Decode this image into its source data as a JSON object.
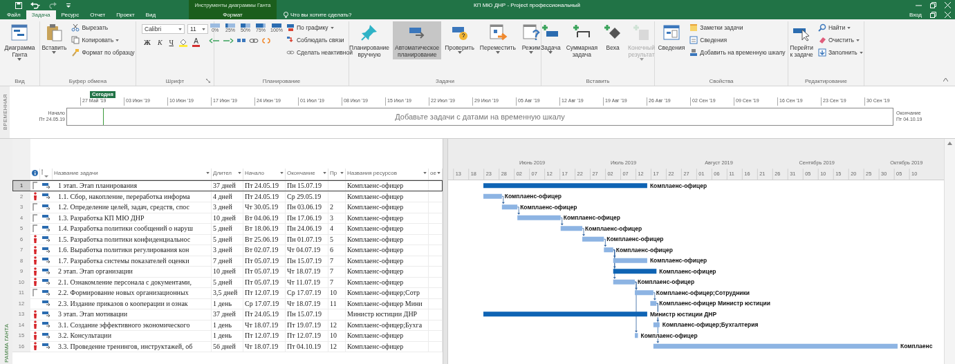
{
  "title_bar": {
    "context_label": "Инструменты диаграммы Ганта",
    "title": "КП МЮ ДНР - Project профессиональный"
  },
  "tabs": [
    {
      "label": "Файл",
      "selected": false,
      "kind": "main"
    },
    {
      "label": "Задача",
      "selected": true,
      "kind": "main"
    },
    {
      "label": "Ресурс",
      "selected": false,
      "kind": "main"
    },
    {
      "label": "Отчет",
      "selected": false,
      "kind": "main"
    },
    {
      "label": "Проект",
      "selected": false,
      "kind": "main"
    },
    {
      "label": "Вид",
      "selected": false,
      "kind": "main"
    },
    {
      "label": "Формат",
      "selected": false,
      "kind": "contextual"
    }
  ],
  "tell_me": "Что вы хотите сделать?",
  "sign_in": "Вход",
  "ribbon": {
    "groups": [
      {
        "label": "Вид",
        "items": [
          {
            "kind": "large",
            "label": "Диаграмма\nГанта",
            "dropdown": true
          }
        ]
      },
      {
        "label": "Буфер обмена",
        "items": [
          {
            "kind": "large",
            "label": "Вставить",
            "dropdown": true
          },
          {
            "kind": "stack",
            "items": [
              {
                "label": "Вырезать"
              },
              {
                "label": "Копировать",
                "dropdown": true
              },
              {
                "label": "Формат по образцу"
              }
            ]
          }
        ]
      },
      {
        "label": "Шрифт",
        "launcher": true,
        "items": [
          {
            "kind": "font",
            "font": "Calibri",
            "size": "11",
            "styles": [
              "Ж",
              "К",
              "Ч"
            ],
            "color_letter": "A"
          }
        ]
      },
      {
        "label": "Планирование",
        "items": [
          {
            "kind": "progress",
            "percents": [
              "0%",
              "25%",
              "50%",
              "75%",
              "100%"
            ]
          },
          {
            "kind": "stack",
            "items": [
              {
                "label": "По графику",
                "dropdown": true
              },
              {
                "label": "Соблюдать связи"
              },
              {
                "label": "Сделать неактивной"
              }
            ]
          }
        ]
      },
      {
        "label": "Задачи",
        "items": [
          {
            "kind": "large",
            "label": "Планирование\nвручную",
            "selected": false
          },
          {
            "kind": "large",
            "label": "Автоматическое\nпланирование",
            "selected": true
          },
          {
            "kind": "large",
            "label": "Проверить",
            "dropdown": true,
            "selected": false
          },
          {
            "kind": "large",
            "label": "Переместить",
            "dropdown": true,
            "selected": false
          },
          {
            "kind": "large",
            "label": "Режим",
            "dropdown": true,
            "selected": false
          }
        ]
      },
      {
        "label": "Вставить",
        "items": [
          {
            "kind": "large",
            "label": "Задача",
            "dropdown": true,
            "disabled": false
          },
          {
            "kind": "large",
            "label": "Суммарная\nзадача",
            "disabled": false
          },
          {
            "kind": "large",
            "label": "Веха",
            "disabled": false
          },
          {
            "kind": "large",
            "label": "Конечный\nрезультат",
            "dropdown": true,
            "disabled": true
          }
        ]
      },
      {
        "label": "Свойства",
        "items": [
          {
            "kind": "large",
            "label": "Сведения"
          },
          {
            "kind": "stack",
            "items": [
              {
                "label": "Заметки задачи"
              },
              {
                "label": "Сведения"
              },
              {
                "label": "Добавить на временную шкалу"
              }
            ]
          }
        ]
      },
      {
        "label": "Редактирование",
        "items": [
          {
            "kind": "large",
            "label": "Перейти\nк задаче"
          },
          {
            "kind": "stack",
            "items": [
              {
                "label": "Найти",
                "dropdown": true
              },
              {
                "label": "Очистить",
                "dropdown": true
              },
              {
                "label": "Заполнить",
                "dropdown": true
              }
            ]
          }
        ]
      }
    ]
  },
  "timeline": {
    "side_label": "ВРЕМЕННАЯ",
    "today": "Сегодня",
    "dates": [
      "27 Май '19",
      "03 Июн '19",
      "10 Июн '19",
      "17 Июн '19",
      "24 Июн '19",
      "01 Июл '19",
      "08 Июл '19",
      "15 Июл '19",
      "22 Июл '19",
      "29 Июл '19",
      "05 Авг '19",
      "12 Авг '19",
      "19 Авг '19",
      "26 Авг '19",
      "02 Сен '19",
      "09 Сен '19",
      "16 Сен '19",
      "23 Сен '19",
      "30 Сен '19"
    ],
    "start_label": "Начало",
    "start_date": "Пт 24.05.19",
    "placeholder": "Добавьте задачи с датами на временную шкалу",
    "end_label": "Окончание",
    "end_date": "Пт 04.10.19"
  },
  "view_label": "РАММА ГАНТА",
  "table": {
    "columns": [
      {
        "label": "Название задачи"
      },
      {
        "label": "Длител"
      },
      {
        "label": "Начало"
      },
      {
        "label": "Окончание"
      },
      {
        "label": "Пр"
      },
      {
        "label": "Названия ресурсов"
      },
      {
        "label": "ое"
      }
    ],
    "rows": [
      {
        "id": "1",
        "constraint": true,
        "overallocated": false,
        "name": "1 этап. Этап планирования",
        "duration": "37 дней",
        "start": "Пт 24.05.19",
        "finish": "Пн 15.07.19",
        "resources": "Комплаенс-офицер",
        "kind": "summary",
        "bar_label": "Комплаенс-офицер",
        "selected": true
      },
      {
        "id": "2",
        "constraint": false,
        "overallocated": true,
        "name": "1.1. Сбор, накопление, переработка информа",
        "duration": "4 дней",
        "start": "Пт 24.05.19",
        "finish": "Ср 29.05.19",
        "resources": "Комплаенс-офицер",
        "kind": "task",
        "bar_label": "Комплаенс-офицер",
        "selected": false
      },
      {
        "id": "3",
        "constraint": true,
        "overallocated": false,
        "name": "1.2. Определение целей, задач, средств, спос",
        "duration": "3 дней",
        "start": "Чт 30.05.19",
        "finish": "Пн 03.06.19",
        "predecessors": "2",
        "resources": "Комплаенс-офицер",
        "kind": "task",
        "bar_label": "Комплаенс-офицер",
        "selected": false
      },
      {
        "id": "4",
        "constraint": true,
        "overallocated": false,
        "name": "1.3. Разработка КП МЮ ДНР",
        "duration": "10 дней",
        "start": "Вт 04.06.19",
        "finish": "Пн 17.06.19",
        "predecessors": "3",
        "resources": "Комплаенс-офицер",
        "kind": "task",
        "bar_label": "Комплаенс-офицер",
        "selected": false
      },
      {
        "id": "5",
        "constraint": true,
        "overallocated": false,
        "name": "1.4. Разработка политики сообщений о наруш",
        "duration": "5 дней",
        "start": "Вт 18.06.19",
        "finish": "Пн 24.06.19",
        "predecessors": "4",
        "resources": "Комплаенс-офицер",
        "kind": "task",
        "bar_label": "Комплаенс-офицер",
        "selected": false
      },
      {
        "id": "6",
        "constraint": false,
        "overallocated": true,
        "name": "1.5. Разработка политики конфиденциальнос",
        "duration": "5 дней",
        "start": "Вт 25.06.19",
        "finish": "Пн 01.07.19",
        "predecessors": "5",
        "resources": "Комплаенс-офицер",
        "kind": "task",
        "bar_label": "Комплаенс-офицер",
        "selected": false
      },
      {
        "id": "7",
        "constraint": false,
        "overallocated": true,
        "name": "1.6. Выработка политики регулирования кон",
        "duration": "3 дней",
        "start": "Вт 02.07.19",
        "finish": "Чт 04.07.19",
        "predecessors": "6",
        "resources": "Комплаенс-офицер",
        "kind": "task",
        "bar_label": "Комплаенс-офицер",
        "selected": false
      },
      {
        "id": "8",
        "constraint": false,
        "overallocated": true,
        "name": "1.7. Разработка системы показателей оценки",
        "duration": "7 дней",
        "start": "Пт 05.07.19",
        "finish": "Пн 15.07.19",
        "predecessors": "7",
        "resources": "Комплаенс-офицер",
        "kind": "task",
        "bar_label": "Комплаенс-офицер",
        "selected": false
      },
      {
        "id": "9",
        "constraint": false,
        "overallocated": true,
        "name": "2 этап. Этап организации",
        "duration": "10 дней",
        "start": "Пт 05.07.19",
        "finish": "Чт 18.07.19",
        "predecessors": "7",
        "resources": "Комплаенс-офицер",
        "kind": "summary",
        "bar_label": "Комплаенс-офицер",
        "selected": false
      },
      {
        "id": "10",
        "constraint": false,
        "overallocated": true,
        "name": "2.1. Ознакомление персонала с документами,",
        "duration": "5 дней",
        "start": "Пт 05.07.19",
        "finish": "Чт 11.07.19",
        "predecessors": "7",
        "resources": "Комплаенс-офицер",
        "kind": "task",
        "bar_label": "Комплаенс-офицер",
        "selected": false
      },
      {
        "id": "11",
        "constraint": true,
        "overallocated": false,
        "name": "2.2. Формирование новых организационных",
        "duration": "3,5 дней",
        "start": "Пт 12.07.19",
        "finish": "Ср 17.07.19",
        "predecessors": "10",
        "resources": "Комплаенс-офицер;Сотр",
        "kind": "task",
        "bar_label": "Комплаенс-офицер;Сотрудники",
        "selected": false
      },
      {
        "id": "12",
        "constraint": false,
        "overallocated": false,
        "name": "2.3. Издание приказов о кооперации и ознак",
        "duration": "1 день",
        "start": "Ср 17.07.19",
        "finish": "Чт 18.07.19",
        "predecessors": "11",
        "resources": "Комплаенс-офицер Мини",
        "kind": "task",
        "bar_label": "Комплаенс-офицер Министр юстиции",
        "selected": false
      },
      {
        "id": "13",
        "constraint": false,
        "overallocated": true,
        "name": "3 этап. Этап мотивации",
        "duration": "37 дней",
        "start": "Пт 24.05.19",
        "finish": "Пн 15.07.19",
        "resources": "Министр юстиции ДНР",
        "kind": "summary",
        "bar_label": "Министр юстиции ДНР",
        "selected": false
      },
      {
        "id": "14",
        "constraint": false,
        "overallocated": true,
        "name": "3.1. Создание эффективного экономического",
        "duration": "1 день",
        "start": "Чт 18.07.19",
        "finish": "Пт 19.07.19",
        "predecessors": "12",
        "resources": "Комплаенс-офицер;Бухга",
        "kind": "task",
        "bar_label": "Комплаенс-офицер;Бухгалтерия",
        "selected": false
      },
      {
        "id": "15",
        "constraint": false,
        "overallocated": true,
        "name": "3.2. Консультации",
        "duration": "1 день",
        "start": "Пт 12.07.19",
        "finish": "Пт 12.07.19",
        "predecessors": "10",
        "resources": "Комплаенс-офицер",
        "kind": "task",
        "bar_label": "Комплаенс-офицер",
        "selected": false
      },
      {
        "id": "16",
        "constraint": false,
        "overallocated": true,
        "name": "3.3. Проведение тренингов, инструктажей, об",
        "duration": "56 дней",
        "start": "Чт 18.07.19",
        "finish": "Пт 04.10.19",
        "predecessors": "12",
        "resources": "Комплаенс-офицер",
        "kind": "task",
        "bar_label": "Комплаенс",
        "selected": false
      }
    ]
  },
  "gantt": {
    "months": [
      "Июнь 2019",
      "Июль 2019",
      "Август 2019",
      "Сентябрь 2019",
      "Октябрь 2019"
    ],
    "days": [
      "13",
      "18",
      "23",
      "28",
      "02",
      "07",
      "12",
      "17",
      "22",
      "27",
      "02",
      "07",
      "12",
      "17",
      "22",
      "27",
      "01",
      "06",
      "11",
      "16",
      "21",
      "26",
      "31",
      "05",
      "10",
      "15",
      "20",
      "25",
      "30",
      "05",
      "10"
    ]
  }
}
